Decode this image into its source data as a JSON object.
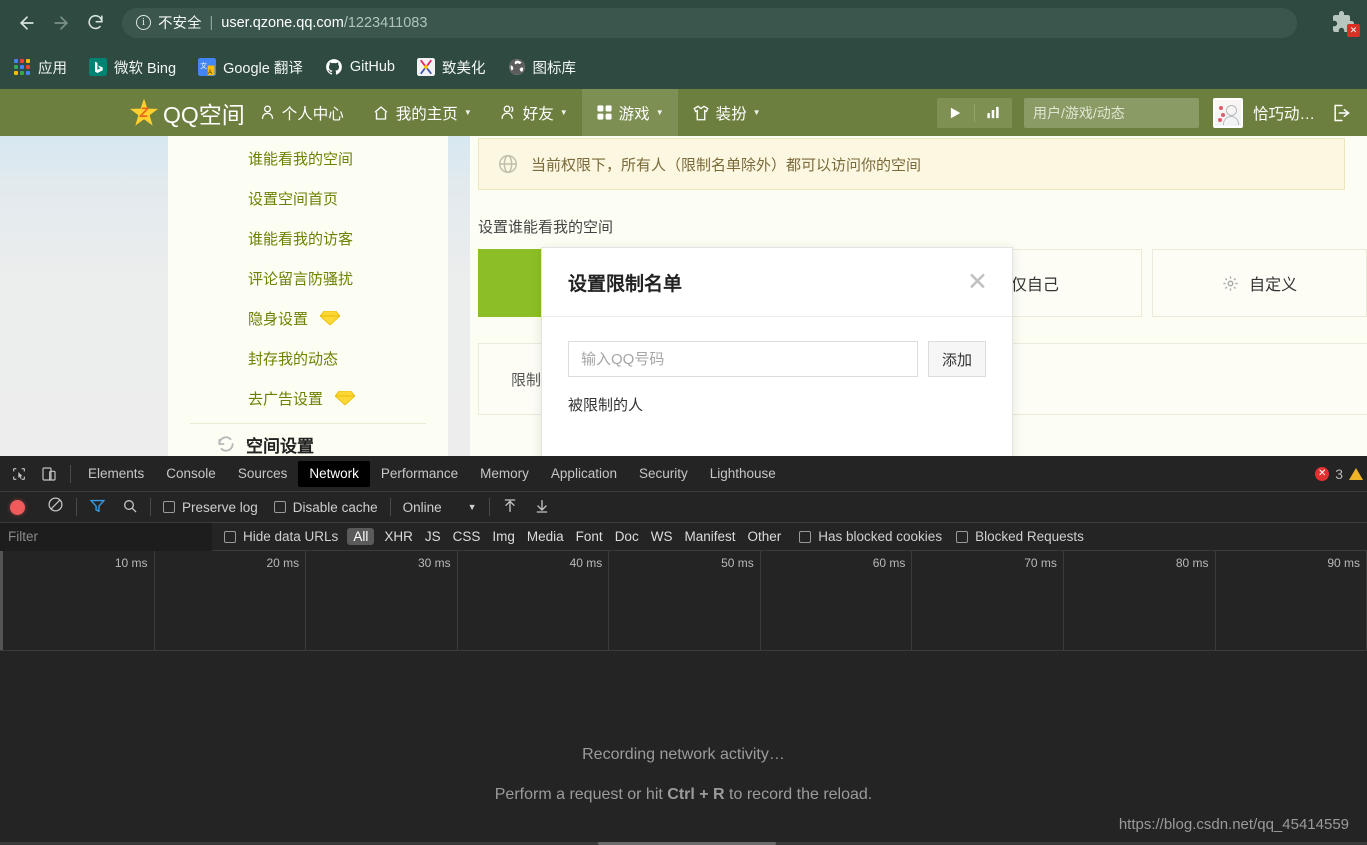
{
  "browser": {
    "back_label": "←",
    "forward_label": "→",
    "reload_label": "⟳",
    "security_label": "不安全",
    "url_host": "user.qzone.qq.com",
    "url_path": "/1223411083",
    "extension_icon": "puzzle-piece-icon",
    "bookmarks": [
      {
        "label": "应用",
        "icon": "apps-grid-icon"
      },
      {
        "label": "微软 Bing",
        "icon": "bing-icon"
      },
      {
        "label": "Google 翻译",
        "icon": "google-translate-icon"
      },
      {
        "label": "GitHub",
        "icon": "github-icon"
      },
      {
        "label": "致美化",
        "icon": "zhimeihua-icon"
      },
      {
        "label": "图标库",
        "icon": "iconlib-icon"
      }
    ]
  },
  "qzone_nav": {
    "brand": "QQ空间",
    "items": [
      {
        "label": "个人中心",
        "icon": "person-icon",
        "caret": false,
        "active": false
      },
      {
        "label": "我的主页",
        "icon": "home-icon",
        "caret": true,
        "active": false
      },
      {
        "label": "好友",
        "icon": "friends-icon",
        "caret": true,
        "active": false
      },
      {
        "label": "游戏",
        "icon": "grid-icon",
        "caret": true,
        "active": true
      },
      {
        "label": "装扮",
        "icon": "shirt-icon",
        "caret": true,
        "active": false
      }
    ],
    "play_icon": "play-icon",
    "chart_icon": "bar-chart-icon",
    "search_placeholder": "用户/游戏/动态",
    "search_value": "",
    "search_icon": "search-icon",
    "avatar": "user-avatar",
    "username": "恰巧动…",
    "logout_icon": "logout-icon"
  },
  "sidebar": {
    "items": [
      {
        "label": "谁能看我的空间",
        "badge": false
      },
      {
        "label": "设置空间首页",
        "badge": false
      },
      {
        "label": "谁能看我的访客",
        "badge": false
      },
      {
        "label": "评论留言防骚扰",
        "badge": false
      },
      {
        "label": "隐身设置",
        "badge": true
      },
      {
        "label": "封存我的动态",
        "badge": false
      },
      {
        "label": "去广告设置",
        "badge": true
      }
    ],
    "section_title": "空间设置",
    "section_icon": "refresh-settings-icon"
  },
  "content": {
    "notice_icon": "globe-icon",
    "notice_text": "当前权限下，所有人（限制名单除外）都可以访问你的空间",
    "section_label": "设置谁能看我的空间",
    "options": [
      {
        "label": "",
        "selected": true,
        "icon": null
      },
      {
        "label": "仅自己",
        "selected": false,
        "icon": null
      },
      {
        "label": "自定义",
        "selected": false,
        "icon": "gear-icon"
      }
    ],
    "limit_label": "限制名单"
  },
  "modal": {
    "title": "设置限制名单",
    "close_icon": "close-icon",
    "input_placeholder": "输入QQ号码",
    "input_value": "",
    "add_button": "添加",
    "list_label": "被限制的人"
  },
  "devtools": {
    "inspect_icon": "inspect-element-icon",
    "device_icon": "device-toolbar-icon",
    "tabs": [
      {
        "label": "Elements",
        "active": false
      },
      {
        "label": "Console",
        "active": false
      },
      {
        "label": "Sources",
        "active": false
      },
      {
        "label": "Network",
        "active": true
      },
      {
        "label": "Performance",
        "active": false
      },
      {
        "label": "Memory",
        "active": false
      },
      {
        "label": "Application",
        "active": false
      },
      {
        "label": "Security",
        "active": false
      },
      {
        "label": "Lighthouse",
        "active": false
      }
    ],
    "error_count": "3",
    "error_icon": "error-icon",
    "warning_icon": "warning-icon",
    "toolbar": {
      "record_icon": "record-icon",
      "clear_icon": "clear-icon",
      "filter_icon": "filter-funnel-icon",
      "search_icon": "search-icon",
      "preserve_log": "Preserve log",
      "disable_cache": "Disable cache",
      "throttling": "Online",
      "import_icon": "import-har-icon",
      "export_icon": "export-har-icon"
    },
    "filter_placeholder": "Filter",
    "filter_value": "",
    "hide_data_urls": "Hide data URLs",
    "types": [
      {
        "label": "All",
        "active": true
      },
      {
        "label": "XHR",
        "active": false
      },
      {
        "label": "JS",
        "active": false
      },
      {
        "label": "CSS",
        "active": false
      },
      {
        "label": "Img",
        "active": false
      },
      {
        "label": "Media",
        "active": false
      },
      {
        "label": "Font",
        "active": false
      },
      {
        "label": "Doc",
        "active": false
      },
      {
        "label": "WS",
        "active": false
      },
      {
        "label": "Manifest",
        "active": false
      },
      {
        "label": "Other",
        "active": false
      }
    ],
    "has_blocked_cookies": "Has blocked cookies",
    "blocked_requests": "Blocked Requests",
    "timeline_ticks": [
      "10 ms",
      "20 ms",
      "30 ms",
      "40 ms",
      "50 ms",
      "60 ms",
      "70 ms",
      "80 ms",
      "90 ms"
    ],
    "empty_line1": "Recording network activity…",
    "empty_line2_pre": "Perform a request or hit ",
    "empty_line2_key": "Ctrl + R",
    "empty_line2_post": " to record the reload.",
    "watermark": "https://blog.csdn.net/qq_45414559"
  }
}
